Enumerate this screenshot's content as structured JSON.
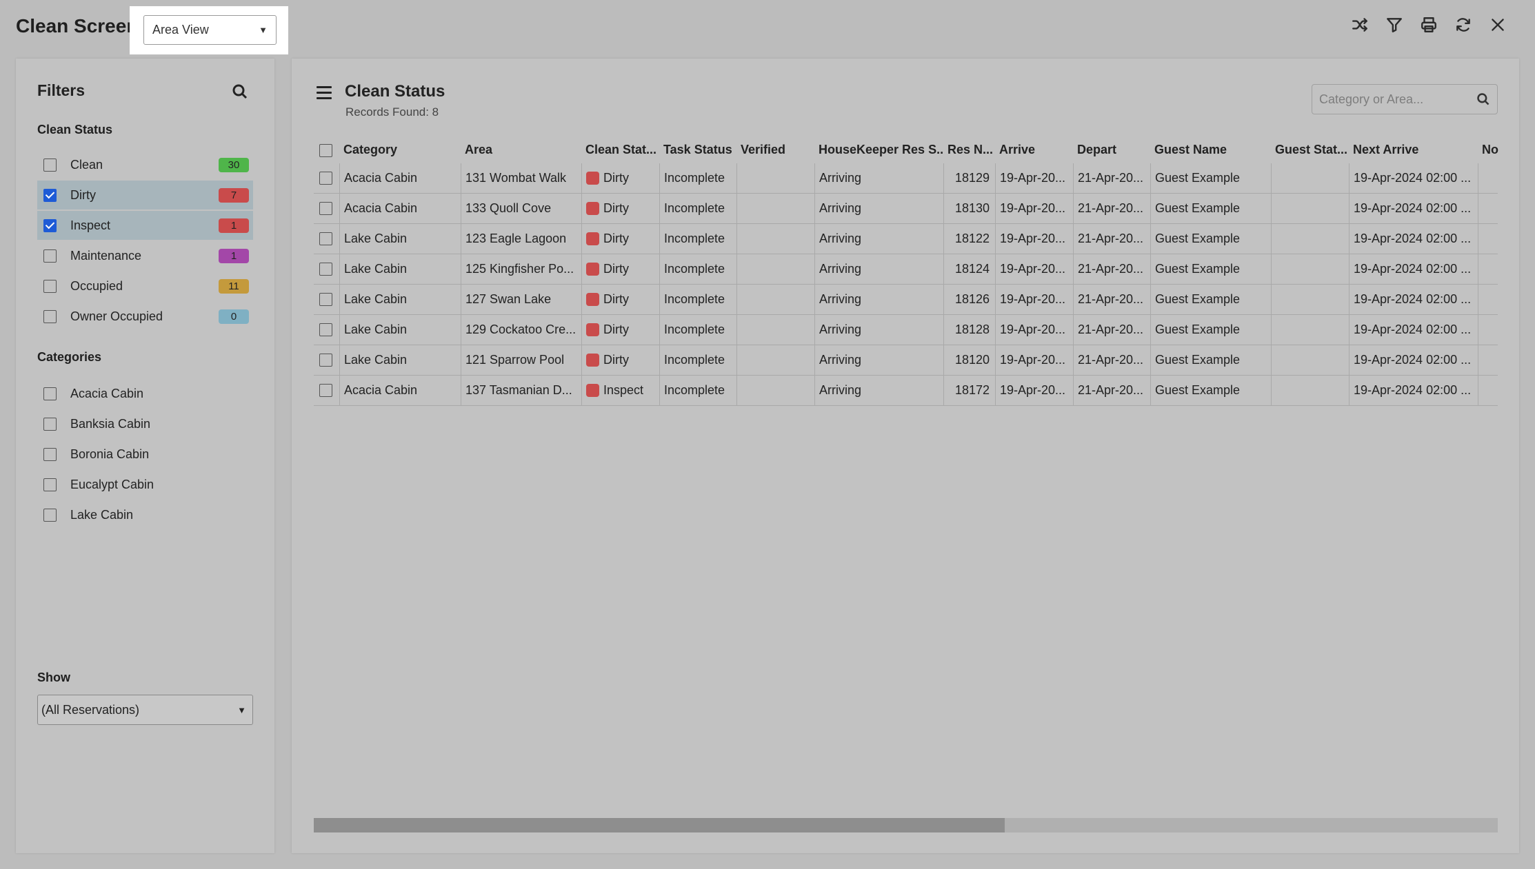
{
  "header": {
    "title": "Clean Screen",
    "view_select": "Area View",
    "icons": [
      "shuffle-icon",
      "filter-icon",
      "print-icon",
      "refresh-icon",
      "close-icon"
    ]
  },
  "filters": {
    "title": "Filters",
    "clean_status_heading": "Clean Status",
    "statuses": [
      {
        "label": "Clean",
        "count": "30",
        "checked": false,
        "color": "#4fb54a"
      },
      {
        "label": "Dirty",
        "count": "7",
        "checked": true,
        "color": "#c94b4b"
      },
      {
        "label": "Inspect",
        "count": "1",
        "checked": true,
        "color": "#c94b4b"
      },
      {
        "label": "Maintenance",
        "count": "1",
        "checked": false,
        "color": "#a347a8"
      },
      {
        "label": "Occupied",
        "count": "11",
        "checked": false,
        "color": "#c49a3c"
      },
      {
        "label": "Owner Occupied",
        "count": "0",
        "checked": false,
        "color": "#7fb0c3"
      }
    ],
    "categories_heading": "Categories",
    "categories": [
      "Acacia Cabin",
      "Banksia Cabin",
      "Boronia Cabin",
      "Eucalypt Cabin",
      "Lake Cabin"
    ],
    "show_heading": "Show",
    "show_value": "(All Reservations)"
  },
  "main": {
    "title": "Clean Status",
    "records_found": "Records Found: 8",
    "search_placeholder": "Category or Area...",
    "columns": [
      "Category",
      "Area",
      "Clean Stat...",
      "Task Status",
      "Verified",
      "HouseKeeper Res S...",
      "Res N...",
      "Arrive",
      "Depart",
      "Guest Name",
      "Guest Stat...",
      "Next Arrive",
      "No"
    ],
    "rows": [
      [
        "Acacia Cabin",
        "131 Wombat Walk",
        "Dirty",
        "Incomplete",
        "",
        "Arriving",
        "18129",
        "19-Apr-20...",
        "21-Apr-20...",
        "Guest Example",
        "",
        "19-Apr-2024 02:00 ...",
        ""
      ],
      [
        "Acacia Cabin",
        "133 Quoll Cove",
        "Dirty",
        "Incomplete",
        "",
        "Arriving",
        "18130",
        "19-Apr-20...",
        "21-Apr-20...",
        "Guest Example",
        "",
        "19-Apr-2024 02:00 ...",
        ""
      ],
      [
        "Lake Cabin",
        "123 Eagle Lagoon",
        "Dirty",
        "Incomplete",
        "",
        "Arriving",
        "18122",
        "19-Apr-20...",
        "21-Apr-20...",
        "Guest Example",
        "",
        "19-Apr-2024 02:00 ...",
        ""
      ],
      [
        "Lake Cabin",
        "125 Kingfisher Po...",
        "Dirty",
        "Incomplete",
        "",
        "Arriving",
        "18124",
        "19-Apr-20...",
        "21-Apr-20...",
        "Guest Example",
        "",
        "19-Apr-2024 02:00 ...",
        ""
      ],
      [
        "Lake Cabin",
        "127 Swan Lake",
        "Dirty",
        "Incomplete",
        "",
        "Arriving",
        "18126",
        "19-Apr-20...",
        "21-Apr-20...",
        "Guest Example",
        "",
        "19-Apr-2024 02:00 ...",
        ""
      ],
      [
        "Lake Cabin",
        "129 Cockatoo Cre...",
        "Dirty",
        "Incomplete",
        "",
        "Arriving",
        "18128",
        "19-Apr-20...",
        "21-Apr-20...",
        "Guest Example",
        "",
        "19-Apr-2024 02:00 ...",
        ""
      ],
      [
        "Lake Cabin",
        "121 Sparrow Pool",
        "Dirty",
        "Incomplete",
        "",
        "Arriving",
        "18120",
        "19-Apr-20...",
        "21-Apr-20...",
        "Guest Example",
        "",
        "19-Apr-2024 02:00 ...",
        ""
      ],
      [
        "Acacia Cabin",
        "137 Tasmanian D...",
        "Inspect",
        "Incomplete",
        "",
        "Arriving",
        "18172",
        "19-Apr-20...",
        "21-Apr-20...",
        "Guest Example",
        "",
        "19-Apr-2024 02:00 ...",
        ""
      ]
    ],
    "clean_status_color": "#c94b4b",
    "scroll_position": 0.58
  }
}
